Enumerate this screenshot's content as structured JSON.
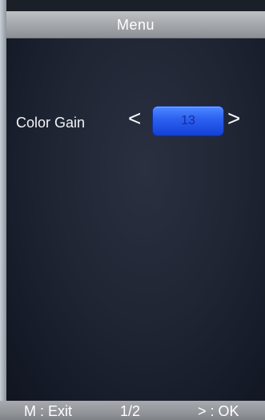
{
  "header": {
    "title": "Menu"
  },
  "setting": {
    "label": "Color Gain",
    "left_arrow": "<",
    "value": "13",
    "right_arrow": ">"
  },
  "footer": {
    "exit": "M : Exit",
    "page": "1/2",
    "ok": "> : OK"
  },
  "colors": {
    "header_bg": "#a7aaae",
    "value_box_bg": "#2d63f2",
    "screen_bg": "#1f2533"
  },
  "icons": [
    "left-arrow-icon",
    "right-arrow-icon"
  ]
}
